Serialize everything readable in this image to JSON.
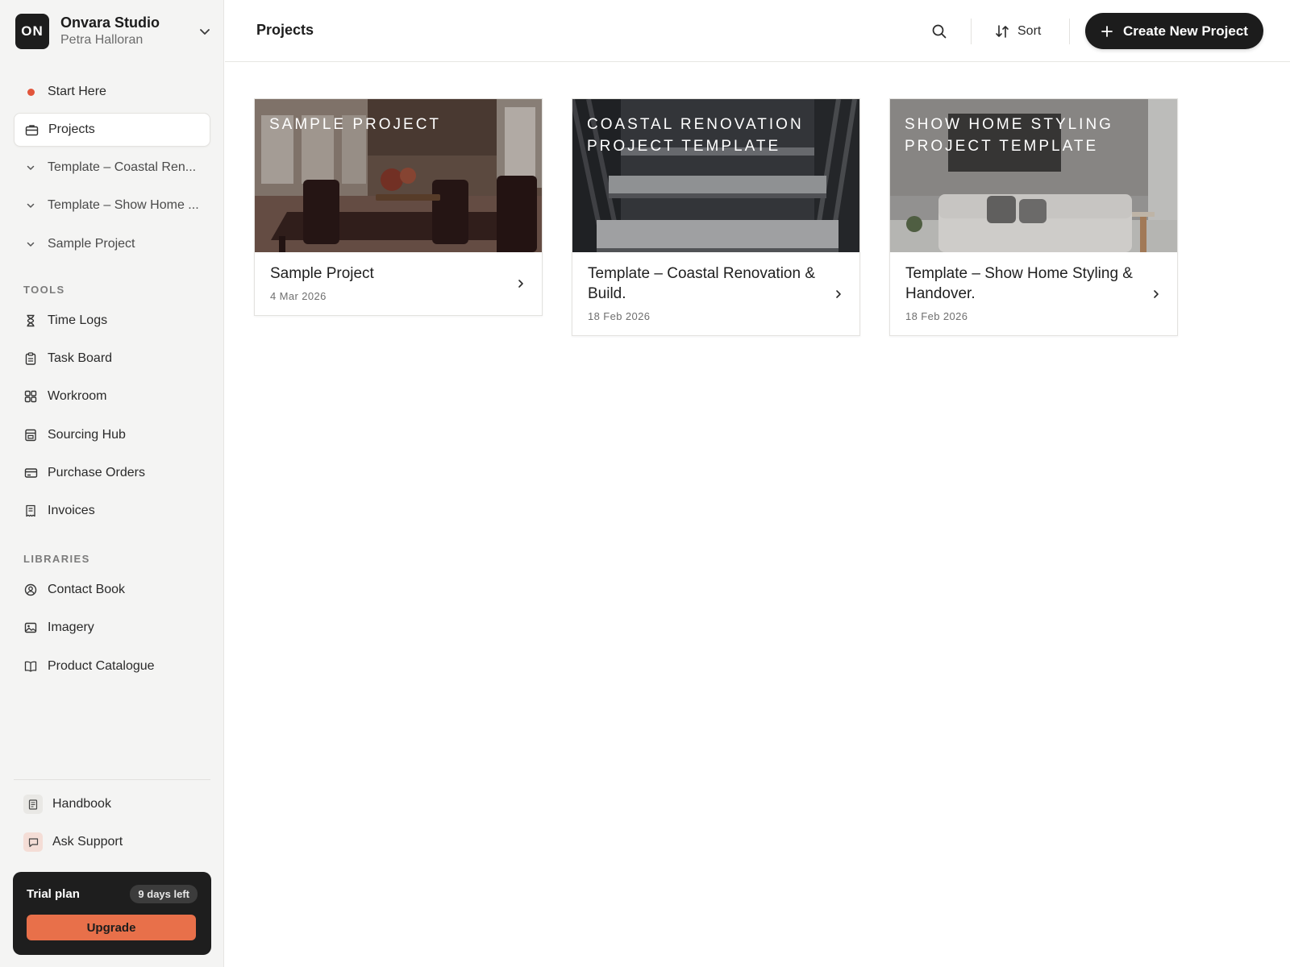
{
  "workspace": {
    "initials": "ON",
    "name": "Onvara Studio",
    "user": "Petra Halloran"
  },
  "nav": {
    "start_here": "Start Here",
    "projects": "Projects",
    "sub_items": [
      "Template – Coastal Ren...",
      "Template – Show Home ...",
      "Sample Project"
    ]
  },
  "tools": {
    "label": "TOOLS",
    "items": [
      "Time Logs",
      "Task Board",
      "Workroom",
      "Sourcing Hub",
      "Purchase Orders",
      "Invoices"
    ]
  },
  "libraries": {
    "label": "LIBRARIES",
    "items": [
      "Contact Book",
      "Imagery",
      "Product Catalogue"
    ]
  },
  "footer": {
    "handbook": "Handbook",
    "ask_support": "Ask Support"
  },
  "trial": {
    "title": "Trial plan",
    "badge": "9 days left",
    "upgrade": "Upgrade"
  },
  "header": {
    "title": "Projects",
    "sort": "Sort",
    "create": "Create New Project"
  },
  "cards": [
    {
      "overlay": "SAMPLE PROJECT",
      "title": "Sample Project",
      "date": "4 Mar 2026"
    },
    {
      "overlay": "COASTAL RENOVATION PROJECT TEMPLATE",
      "title": "Template – Coastal Renovation & Build.",
      "date": "18 Feb 2026"
    },
    {
      "overlay": "SHOW HOME STYLING PROJECT TEMPLATE",
      "title": "Template – Show Home Styling & Handover.",
      "date": "18 Feb 2026"
    }
  ],
  "colors": {
    "accent": "#e8704a",
    "dot": "#e2553b",
    "dark": "#1c1c1c"
  }
}
